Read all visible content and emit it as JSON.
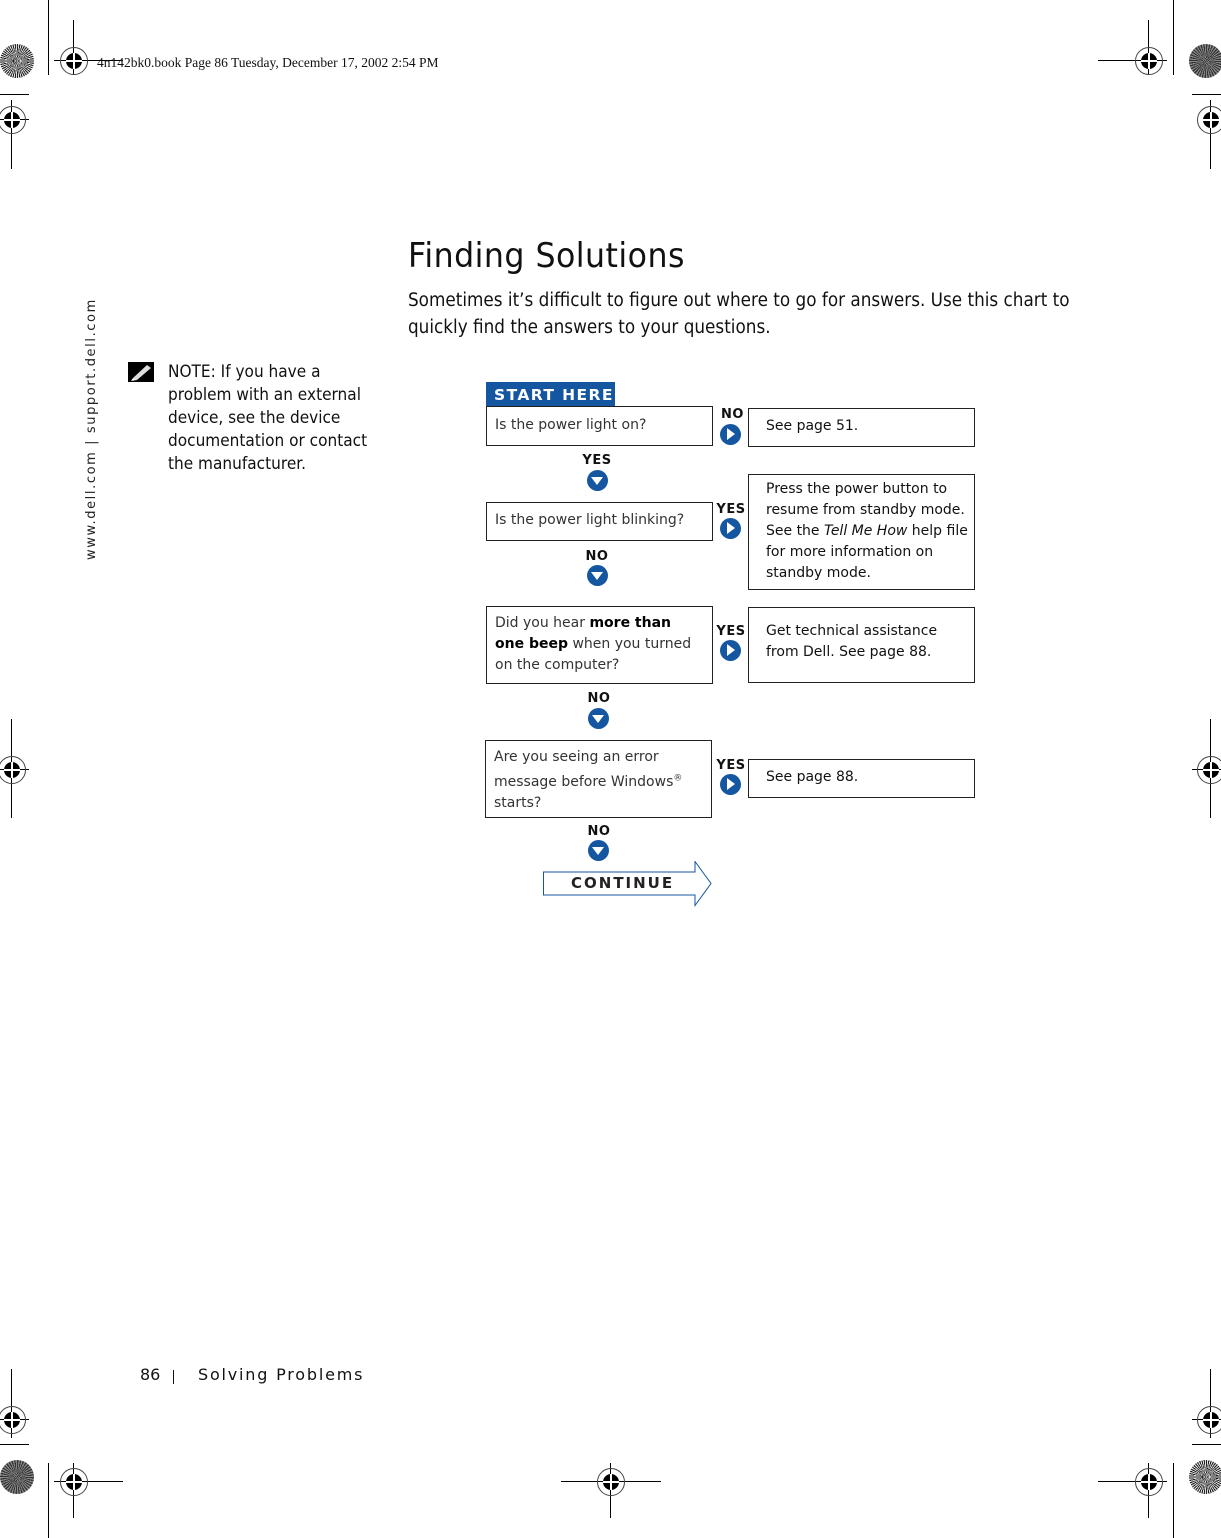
{
  "slug_line": "4n142bk0.book  Page 86  Tuesday, December 17, 2002  2:54 PM",
  "side_url": "www.dell.com | support.dell.com",
  "page": {
    "title": "Finding Solutions",
    "intro": "Sometimes it’s difficult to figure out where to go for answers. Use this chart to quickly find the answers to your questions."
  },
  "note": {
    "icon": "pencil-note-icon",
    "text": "NOTE: If you have a problem with an external device, see the device documentation or contact the manufacturer."
  },
  "flowchart": {
    "start_label": "START HERE",
    "colors": {
      "accent": "#1456a0"
    },
    "steps": [
      {
        "question": "Is the power light on?",
        "side_label": "NO",
        "answer": "See page 51.",
        "down_label": "YES"
      },
      {
        "question": "Is the power light blinking?",
        "side_label": "YES",
        "answer_parts": [
          "Press the power button to resume from standby mode. See the ",
          "Tell Me How",
          " help file for more information on standby mode."
        ],
        "down_label": "NO"
      },
      {
        "question_parts": [
          "Did you hear ",
          "more than one beep",
          " when you turned on the computer?"
        ],
        "side_label": "YES",
        "answer": "Get technical assistance from Dell. See page 88.",
        "down_label": "NO"
      },
      {
        "question_parts": [
          "Are you seeing an error message before Windows",
          "®",
          " starts?"
        ],
        "side_label": "YES",
        "answer": "See page 88.",
        "down_label": "NO"
      }
    ],
    "continue_label": "CONTINUE"
  },
  "footer": {
    "page_number": "86",
    "section": "Solving Problems"
  }
}
